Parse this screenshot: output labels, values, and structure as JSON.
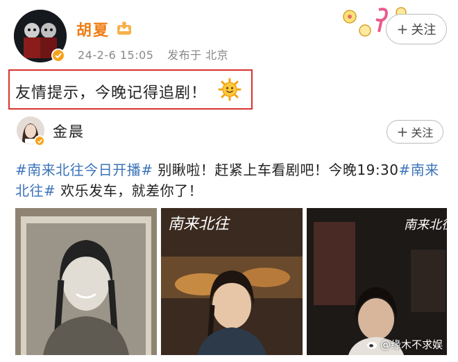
{
  "post": {
    "author": "胡夏",
    "date": "24-2-6 15:05",
    "location": "发布于 北京",
    "follow_label": "关注",
    "text": "友情提示，今晚记得追剧！"
  },
  "repost": {
    "author": "金晨",
    "follow_label": "关注",
    "tag1": "#南来北往今日开播#",
    "text1": " 别瞅啦！赶紧上车看剧吧！今晚19:30",
    "tag2": "#南来北往#",
    "text2": " 欢乐发车，就差你了！",
    "images": [
      {
        "description": "vintage portrait photo"
      },
      {
        "description": "drama still",
        "overlay": "南来北往"
      },
      {
        "description": "drama still",
        "overlay": "南来北往"
      }
    ]
  },
  "watermark": "@缘木不求娱",
  "colors": {
    "accent": "#ef7d14",
    "link": "#3b73b9",
    "highlight_border": "#d8322f",
    "verified": "#f7a21b"
  }
}
